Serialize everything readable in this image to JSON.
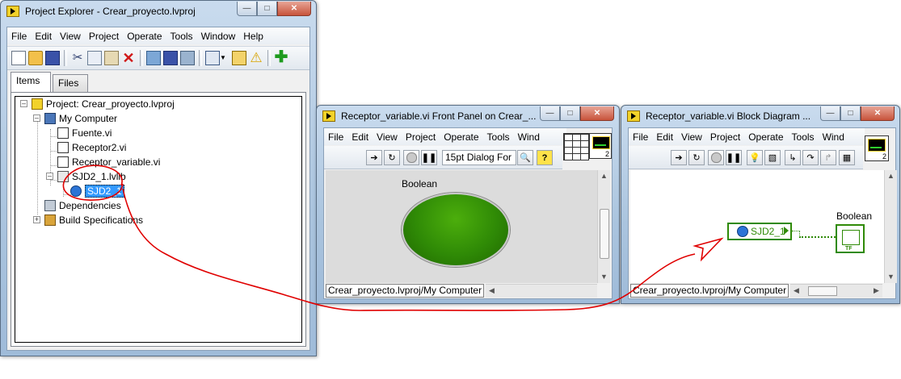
{
  "project_explorer": {
    "title": "Project Explorer - Crear_proyecto.lvproj",
    "menu": [
      "File",
      "Edit",
      "View",
      "Project",
      "Operate",
      "Tools",
      "Window",
      "Help"
    ],
    "tabs": {
      "items": "Items",
      "files": "Files"
    },
    "tree": {
      "project": "Project: Crear_proyecto.lvproj",
      "computer": "My Computer",
      "vi_1": "Fuente.vi",
      "vi_2": "Receptor2.vi",
      "vi_3": "Receptor_variable.vi",
      "library": "SJD2_1.lvlib",
      "variable": "SJD2_1",
      "dependencies": "Dependencies",
      "build": "Build Specifications"
    }
  },
  "front_panel": {
    "title": "Receptor_variable.vi Front Panel on Crear_...",
    "menu": [
      "File",
      "Edit",
      "View",
      "Project",
      "Operate",
      "Tools",
      "Wind"
    ],
    "font_select": "15pt Dialog For",
    "control_label": "Boolean",
    "led_color": "#2f8a06",
    "status_path": "Crear_proyecto.lvproj/My Computer",
    "icon_number": "2"
  },
  "block_diagram": {
    "title": "Receptor_variable.vi Block Diagram ...",
    "menu": [
      "File",
      "Edit",
      "View",
      "Project",
      "Operate",
      "Tools",
      "Wind"
    ],
    "node_label": "SJD2_1",
    "terminal_label": "Boolean",
    "terminal_text": "TF",
    "status_path": "Crear_proyecto.lvproj/My Computer",
    "icon_number": "2"
  },
  "colors": {
    "highlight": "#3399ff",
    "annotation": "#e00000",
    "wire_green": "#2f8a06"
  }
}
